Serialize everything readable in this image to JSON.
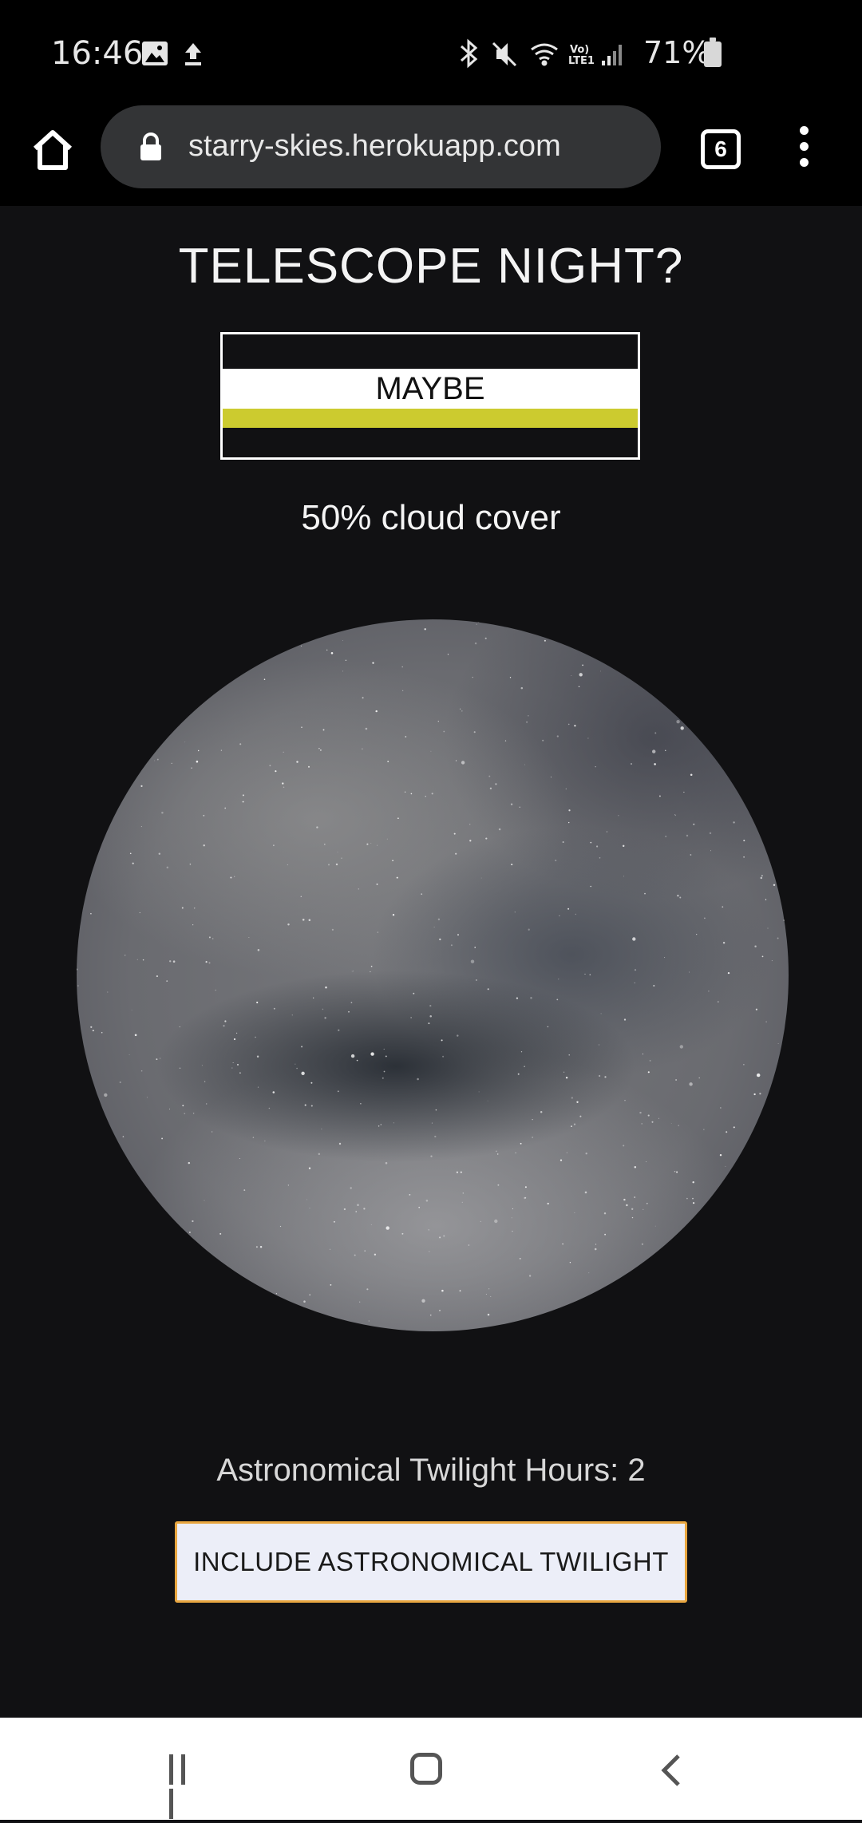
{
  "status_bar": {
    "time": "16:46",
    "battery": "71%",
    "left_icons": [
      "image-icon",
      "upload-icon"
    ],
    "right_icons": [
      "bluetooth-icon",
      "mute-icon",
      "wifi-icon",
      "volte-icon",
      "signal-icon",
      "battery-icon"
    ],
    "volte_label": "Vo) LTE1"
  },
  "browser": {
    "url": "starry-skies.herokuapp.com",
    "tab_count": "6"
  },
  "page": {
    "title": "TELESCOPE NIGHT?",
    "verdict": "MAYBE",
    "verdict_color": "#cccb2f",
    "cloud_cover": "50% cloud cover",
    "twilight_hours": "Astronomical Twilight Hours: 2",
    "include_button": "INCLUDE ASTRONOMICAL TWILIGHT",
    "button_border_color": "#e8a640"
  },
  "nav_bar": {
    "buttons": [
      "recents-icon",
      "home-icon",
      "back-icon"
    ]
  }
}
